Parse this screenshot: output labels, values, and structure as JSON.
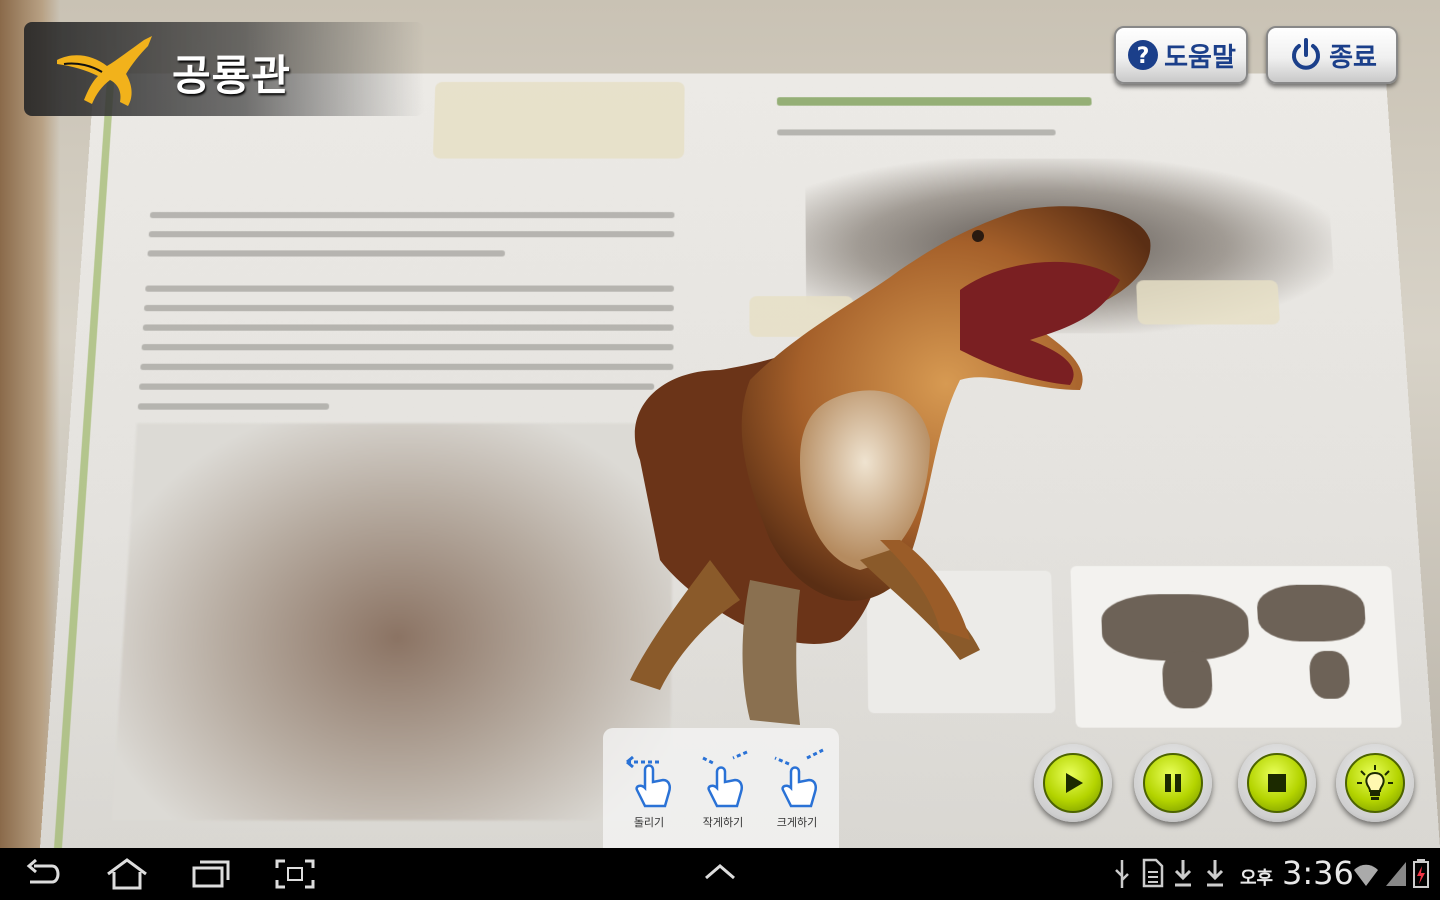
{
  "app": {
    "title": "공룡관"
  },
  "toolbar": {
    "help_label": "도움말",
    "exit_label": "종료"
  },
  "gestures": [
    {
      "label": "돌리기",
      "icon": "swipe-rotate-icon"
    },
    {
      "label": "작게하기",
      "icon": "pinch-shrink-icon"
    },
    {
      "label": "크게하기",
      "icon": "pinch-enlarge-icon"
    }
  ],
  "media_controls": [
    {
      "name": "play",
      "icon": "play-icon"
    },
    {
      "name": "pause",
      "icon": "pause-icon"
    },
    {
      "name": "stop",
      "icon": "stop-icon"
    },
    {
      "name": "hint",
      "icon": "lightbulb-icon"
    }
  ],
  "status_bar": {
    "ampm": "오후",
    "time": "3:36"
  },
  "colors": {
    "button_text": "#1b3f8a",
    "media_green": "#b4d400",
    "title_text": "#ffffff"
  }
}
